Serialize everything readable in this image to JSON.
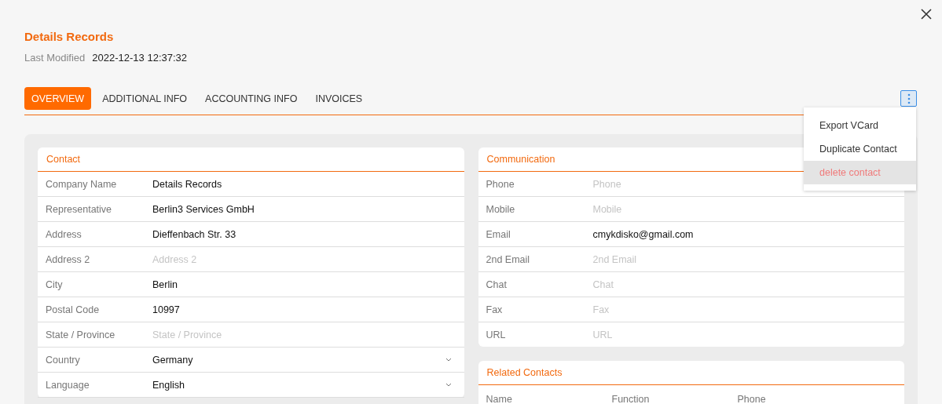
{
  "header": {
    "title": "Details Records",
    "modified_label": "Last Modified",
    "modified_value": "2022-12-13 12:37:32"
  },
  "tabs": [
    {
      "label": "OVERVIEW",
      "selected": true
    },
    {
      "label": "ADDITIONAL INFO",
      "selected": false
    },
    {
      "label": "ACCOUNTING INFO",
      "selected": false
    },
    {
      "label": "INVOICES",
      "selected": false
    }
  ],
  "menu": {
    "items": [
      {
        "label": "Export VCard",
        "kind": "normal",
        "selected": false
      },
      {
        "label": "Duplicate Contact",
        "kind": "normal",
        "selected": false
      },
      {
        "label": "delete contact",
        "kind": "danger",
        "selected": true
      }
    ]
  },
  "contact": {
    "title": "Contact",
    "fields": [
      {
        "label": "Company Name",
        "kind": "text",
        "value": "Details Records"
      },
      {
        "label": "Representative",
        "kind": "text",
        "value": "Berlin3 Services GmbH"
      },
      {
        "label": "Address",
        "kind": "text",
        "value": "Dieffenbach Str. 33"
      },
      {
        "label": "Address 2",
        "kind": "text",
        "placeholder": "Address 2"
      },
      {
        "label": "City",
        "kind": "text",
        "value": "Berlin"
      },
      {
        "label": "Postal Code",
        "kind": "text",
        "value": "10997"
      },
      {
        "label": "State / Province",
        "kind": "text",
        "placeholder": "State / Province"
      },
      {
        "label": "Country",
        "kind": "select",
        "value": "Germany"
      },
      {
        "label": "Language",
        "kind": "select",
        "value": "English"
      }
    ]
  },
  "communication": {
    "title": "Communication",
    "fields": [
      {
        "label": "Phone",
        "kind": "text",
        "placeholder": "Phone"
      },
      {
        "label": "Mobile",
        "kind": "text",
        "placeholder": "Mobile"
      },
      {
        "label": "Email",
        "kind": "text",
        "value": "cmykdisko@gmail.com"
      },
      {
        "label": "2nd Email",
        "kind": "text",
        "placeholder": "2nd Email"
      },
      {
        "label": "Chat",
        "kind": "text",
        "placeholder": "Chat"
      },
      {
        "label": "Fax",
        "kind": "text",
        "placeholder": "Fax"
      },
      {
        "label": "URL",
        "kind": "text",
        "placeholder": "URL"
      }
    ]
  },
  "related_contacts": {
    "title": "Related Contacts",
    "columns": [
      "Name",
      "Function",
      "Phone"
    ]
  }
}
